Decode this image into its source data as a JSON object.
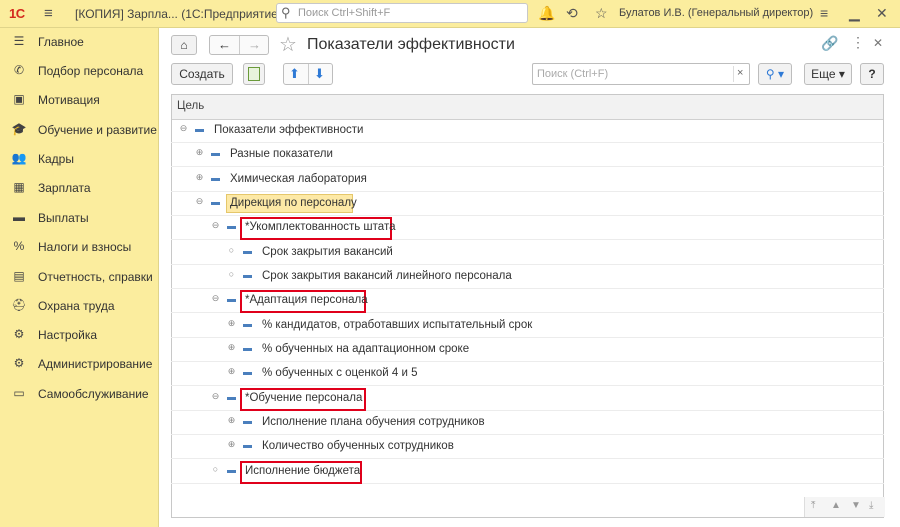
{
  "topbar": {
    "logo": "1С",
    "app_title": "[КОПИЯ] Зарпла...  (1С:Предприятие)",
    "search_placeholder": "Поиск Ctrl+Shift+F",
    "user": "Булатов И.В. (Генеральный директор)",
    "icons": [
      "bell-icon",
      "history-icon",
      "star-icon",
      "menu-icon",
      "minimize-icon",
      "close-icon"
    ]
  },
  "sidebar": {
    "items": [
      {
        "label": "Главное",
        "icon": "☰"
      },
      {
        "label": "Подбор персонала",
        "icon": "✆"
      },
      {
        "label": "Мотивация",
        "icon": "▣"
      },
      {
        "label": "Обучение и развитие",
        "icon": "🎓"
      },
      {
        "label": "Кадры",
        "icon": "👥"
      },
      {
        "label": "Зарплата",
        "icon": "▦"
      },
      {
        "label": "Выплаты",
        "icon": "▬"
      },
      {
        "label": "Налоги и взносы",
        "icon": "%"
      },
      {
        "label": "Отчетность, справки",
        "icon": "▤"
      },
      {
        "label": "Охрана труда",
        "icon": "⛑"
      },
      {
        "label": "Настройка",
        "icon": "⚙"
      },
      {
        "label": "Администрирование",
        "icon": "⚙"
      },
      {
        "label": "Самообслуживание",
        "icon": "▭"
      }
    ]
  },
  "main": {
    "title": "Показатели эффективности",
    "toolbar": {
      "create": "Создать",
      "search_placeholder": "Поиск (Ctrl+F)",
      "more": "Еще",
      "help": "?"
    },
    "column_header": "Цель",
    "tree": [
      {
        "label": "Показатели эффективности",
        "level": 0,
        "toggle": "⊖"
      },
      {
        "label": "Разные показатели",
        "level": 1,
        "toggle": "⊕"
      },
      {
        "label": "Химическая лаборатория",
        "level": 1,
        "toggle": "⊕"
      },
      {
        "label": "Дирекция по персоналу",
        "level": 1,
        "toggle": "⊖"
      },
      {
        "label": "*Укомплектованность штата",
        "level": 2,
        "toggle": "⊖"
      },
      {
        "label": "Срок закрытия вакансий",
        "level": 3,
        "toggle": "○"
      },
      {
        "label": "Срок закрытия вакансий линейного персонала",
        "level": 3,
        "toggle": "○"
      },
      {
        "label": "*Адаптация персонала",
        "level": 2,
        "toggle": "⊖"
      },
      {
        "label": "% кандидатов, отработавших испытательный срок",
        "level": 3,
        "toggle": "⊕"
      },
      {
        "label": "% обученных на адаптационном сроке",
        "level": 3,
        "toggle": "⊕"
      },
      {
        "label": "% обученных с оценкой 4 и 5",
        "level": 3,
        "toggle": "⊕"
      },
      {
        "label": "*Обучение персонала",
        "level": 2,
        "toggle": "⊖"
      },
      {
        "label": "Исполнение плана обучения сотрудников",
        "level": 3,
        "toggle": "⊕"
      },
      {
        "label": "Количество обученных сотрудников",
        "level": 3,
        "toggle": "⊕"
      },
      {
        "label": "Исполнение бюджета",
        "level": 2,
        "toggle": "○"
      }
    ]
  }
}
